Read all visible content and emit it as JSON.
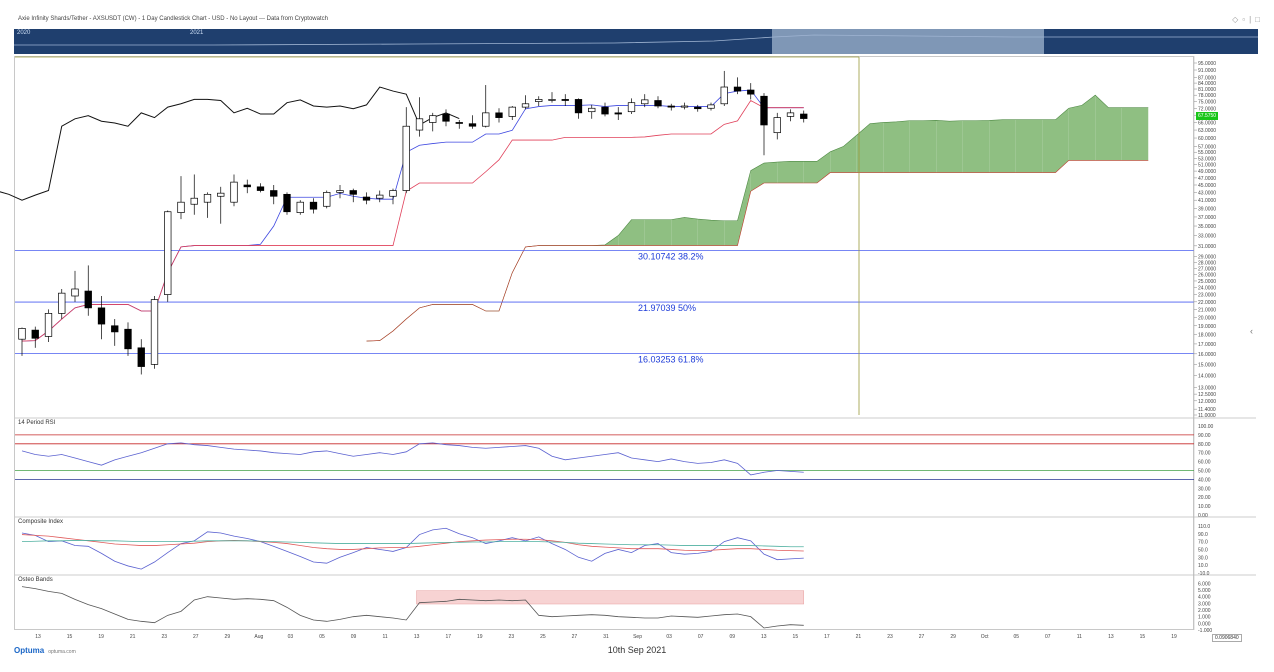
{
  "header": {
    "title": "Axie Infinity Shards/Tether - AXSUSDT (CW) - 1 Day Candlestick Chart - USD - No Layout --- Data from Cryptowatch",
    "icons": [
      "diamond-icon",
      "minimize-icon",
      "settings-icon",
      "close-icon"
    ]
  },
  "navigator": {
    "year_labels": [
      "2020",
      "2021"
    ]
  },
  "price_tag": "67.5750",
  "footer": {
    "logo": "Optuma",
    "site": "optuma.com",
    "date": "10th Sep 2021",
    "zoom": "0.0906840"
  },
  "colors": {
    "cloud": "#8fbf82",
    "tenkan": "#3d47e0",
    "kijun": "#e0405a",
    "chikou": "#111111",
    "fib": "#4a5ef0",
    "rsi": "#5a61d0"
  },
  "chart_data": [
    {
      "type": "candlestick",
      "title": "Axie Infinity Shards/Tether - AXSUSDT (CW) - 1 Day Candlestick Chart",
      "y_axis_labels": [
        "95.0000",
        "91.0000",
        "87.0000",
        "84.0000",
        "81.0000",
        "78.0000",
        "75.0000",
        "72.0000",
        "69.0000",
        "66.0000",
        "63.0000",
        "60.0000",
        "57.0000",
        "55.0000",
        "53.0000",
        "51.0000",
        "49.0000",
        "47.0000",
        "45.0000",
        "43.0000",
        "41.0000",
        "39.0000",
        "37.0000",
        "35.0000",
        "33.0000",
        "31.0000",
        "29.0000",
        "28.0000",
        "27.0000",
        "26.0000",
        "25.0000",
        "24.0000",
        "23.0000",
        "22.0000",
        "21.0000",
        "20.0000",
        "19.0000",
        "18.0000",
        "17.0000",
        "16.0000",
        "15.0000",
        "14.0000",
        "13.0000",
        "12.5000",
        "12.0000",
        "11.4000",
        "11.0000"
      ],
      "x_axis_labels": [
        "13",
        "15",
        "19",
        "21",
        "23",
        "27",
        "29",
        "Aug",
        "03",
        "05",
        "09",
        "11",
        "13",
        "17",
        "19",
        "23",
        "25",
        "27",
        "31",
        "Sep",
        "03",
        "07",
        "09",
        "13",
        "15",
        "17",
        "21",
        "23",
        "27",
        "29",
        "Oct",
        "05",
        "07",
        "11",
        "13",
        "15",
        "19"
      ],
      "candles": [
        {
          "o": 17.5,
          "h": 18.8,
          "l": 15.8,
          "c": 18.7
        },
        {
          "o": 18.5,
          "h": 18.9,
          "l": 16.6,
          "c": 17.6
        },
        {
          "o": 17.8,
          "h": 21.0,
          "l": 17.2,
          "c": 20.5
        },
        {
          "o": 20.5,
          "h": 23.8,
          "l": 19.8,
          "c": 23.2
        },
        {
          "o": 22.8,
          "h": 26.6,
          "l": 22.0,
          "c": 23.8
        },
        {
          "o": 23.5,
          "h": 27.5,
          "l": 20.2,
          "c": 21.2
        },
        {
          "o": 21.2,
          "h": 22.8,
          "l": 17.5,
          "c": 19.2
        },
        {
          "o": 19.0,
          "h": 19.8,
          "l": 16.8,
          "c": 18.3
        },
        {
          "o": 18.6,
          "h": 19.4,
          "l": 15.8,
          "c": 16.5
        },
        {
          "o": 16.6,
          "h": 17.5,
          "l": 14.1,
          "c": 14.8
        },
        {
          "o": 15.0,
          "h": 22.8,
          "l": 14.6,
          "c": 22.3
        },
        {
          "o": 23.0,
          "h": 38.5,
          "l": 22.0,
          "c": 38.2
        },
        {
          "o": 38.0,
          "h": 47.5,
          "l": 36.5,
          "c": 40.5
        },
        {
          "o": 40.0,
          "h": 48.0,
          "l": 37.5,
          "c": 41.5
        },
        {
          "o": 40.5,
          "h": 43.0,
          "l": 36.8,
          "c": 42.5
        },
        {
          "o": 42.0,
          "h": 44.5,
          "l": 35.5,
          "c": 42.8
        },
        {
          "o": 40.5,
          "h": 48.0,
          "l": 39.5,
          "c": 45.8
        },
        {
          "o": 45.0,
          "h": 46.5,
          "l": 42.8,
          "c": 44.5
        },
        {
          "o": 44.5,
          "h": 45.5,
          "l": 43.0,
          "c": 43.5
        },
        {
          "o": 43.5,
          "h": 45.0,
          "l": 40.0,
          "c": 42.0
        },
        {
          "o": 42.5,
          "h": 43.0,
          "l": 37.5,
          "c": 38.2
        },
        {
          "o": 38.0,
          "h": 41.0,
          "l": 37.5,
          "c": 40.5
        },
        {
          "o": 40.5,
          "h": 41.5,
          "l": 37.8,
          "c": 38.8
        },
        {
          "o": 39.5,
          "h": 43.5,
          "l": 39.0,
          "c": 43.0
        },
        {
          "o": 43.0,
          "h": 45.0,
          "l": 41.5,
          "c": 43.5
        },
        {
          "o": 43.5,
          "h": 44.0,
          "l": 40.5,
          "c": 42.5
        },
        {
          "o": 41.8,
          "h": 43.0,
          "l": 40.0,
          "c": 41.0
        },
        {
          "o": 41.5,
          "h": 43.5,
          "l": 40.5,
          "c": 42.3
        },
        {
          "o": 42.0,
          "h": 44.0,
          "l": 40.0,
          "c": 43.5
        },
        {
          "o": 43.5,
          "h": 72.5,
          "l": 42.8,
          "c": 64.5
        },
        {
          "o": 63.0,
          "h": 77.0,
          "l": 60.5,
          "c": 67.5
        },
        {
          "o": 66.0,
          "h": 70.0,
          "l": 62.5,
          "c": 68.8
        },
        {
          "o": 69.5,
          "h": 71.5,
          "l": 64.5,
          "c": 66.5
        },
        {
          "o": 66.0,
          "h": 67.0,
          "l": 63.5,
          "c": 65.8
        },
        {
          "o": 65.5,
          "h": 69.0,
          "l": 63.5,
          "c": 64.5
        },
        {
          "o": 64.5,
          "h": 83.0,
          "l": 64.0,
          "c": 70.0
        },
        {
          "o": 70.0,
          "h": 72.0,
          "l": 66.0,
          "c": 68.0
        },
        {
          "o": 68.5,
          "h": 73.0,
          "l": 67.0,
          "c": 72.5
        },
        {
          "o": 72.5,
          "h": 78.0,
          "l": 71.5,
          "c": 74.0
        },
        {
          "o": 75.0,
          "h": 77.5,
          "l": 73.0,
          "c": 76.0
        },
        {
          "o": 76.0,
          "h": 79.5,
          "l": 74.5,
          "c": 76.0
        },
        {
          "o": 76.0,
          "h": 78.5,
          "l": 73.0,
          "c": 75.5
        },
        {
          "o": 76.0,
          "h": 76.5,
          "l": 67.5,
          "c": 70.0
        },
        {
          "o": 70.5,
          "h": 73.5,
          "l": 67.5,
          "c": 72.0
        },
        {
          "o": 72.5,
          "h": 74.5,
          "l": 68.5,
          "c": 69.5
        },
        {
          "o": 70.0,
          "h": 72.5,
          "l": 67.0,
          "c": 69.5
        },
        {
          "o": 70.5,
          "h": 76.5,
          "l": 69.5,
          "c": 74.5
        },
        {
          "o": 74.0,
          "h": 78.5,
          "l": 72.5,
          "c": 75.8
        },
        {
          "o": 75.5,
          "h": 77.5,
          "l": 72.0,
          "c": 73.0
        },
        {
          "o": 73.0,
          "h": 74.0,
          "l": 71.0,
          "c": 72.5
        },
        {
          "o": 72.5,
          "h": 74.5,
          "l": 71.5,
          "c": 73.0
        },
        {
          "o": 72.5,
          "h": 73.5,
          "l": 70.5,
          "c": 71.8
        },
        {
          "o": 72.0,
          "h": 74.5,
          "l": 71.0,
          "c": 73.5
        },
        {
          "o": 74.0,
          "h": 90.5,
          "l": 73.0,
          "c": 82.0
        },
        {
          "o": 82.0,
          "h": 87.0,
          "l": 78.5,
          "c": 80.0
        },
        {
          "o": 80.5,
          "h": 84.0,
          "l": 76.0,
          "c": 78.5
        },
        {
          "o": 77.5,
          "h": 79.0,
          "l": 54.0,
          "c": 65.0
        },
        {
          "o": 62.0,
          "h": 70.0,
          "l": 59.5,
          "c": 68.0
        },
        {
          "o": 68.5,
          "h": 71.5,
          "l": 66.5,
          "c": 70.0
        },
        {
          "o": 69.5,
          "h": 71.0,
          "l": 66.0,
          "c": 67.6
        }
      ],
      "fib_levels": [
        {
          "price": 30.10742,
          "label": "30.10742",
          "pct": "38.2%"
        },
        {
          "price": 21.97039,
          "label": "21.97039",
          "pct": "50%"
        },
        {
          "price": 16.03253,
          "label": "16.03253",
          "pct": "61.8%"
        }
      ],
      "last_price": 67.575
    },
    {
      "type": "line",
      "title": "14 Period RSI",
      "y_axis_labels": [
        "100.00",
        "90.00",
        "80.00",
        "70.00",
        "60.00",
        "50.00",
        "40.00",
        "30.00",
        "20.00",
        "10.00",
        "0.00"
      ],
      "ylim": [
        0,
        100
      ],
      "levels": [
        90,
        80,
        50,
        40
      ],
      "values": [
        72,
        68,
        66,
        68,
        64,
        60,
        56,
        62,
        66,
        70,
        75,
        80,
        81,
        79,
        78,
        76,
        74,
        73,
        72,
        70,
        69,
        68,
        71,
        72,
        69,
        66,
        68,
        70,
        68,
        71,
        80,
        81,
        79,
        78,
        76,
        75,
        76,
        77,
        78,
        75,
        66,
        62,
        64,
        66,
        68,
        70,
        64,
        62,
        60,
        63,
        60,
        58,
        59,
        62,
        58,
        45,
        48,
        50,
        49,
        48
      ]
    },
    {
      "type": "line",
      "title": "Composite Index",
      "y_axis_labels": [
        "110.0",
        "90.0",
        "70.0",
        "50.0",
        "30.0",
        "10.0",
        "-10.0"
      ],
      "ylim": [
        -10,
        120
      ],
      "series": [
        {
          "values": [
            92,
            86,
            70,
            72,
            60,
            58,
            40,
            20,
            8,
            0,
            18,
            42,
            65,
            72,
            95,
            92,
            84,
            78,
            70,
            58,
            45,
            32,
            18,
            15,
            30,
            42,
            55,
            50,
            45,
            55,
            88,
            100,
            104,
            90,
            80,
            65,
            72,
            80,
            72,
            82,
            65,
            50,
            30,
            20,
            40,
            50,
            42,
            60,
            65,
            42,
            38,
            40,
            45,
            70,
            80,
            72,
            38,
            24,
            26,
            28
          ]
        },
        {
          "values": [
            88,
            86,
            84,
            80,
            76,
            72,
            68,
            64,
            62,
            60,
            60,
            62,
            64,
            66,
            70,
            72,
            73,
            72,
            70,
            68,
            65,
            60,
            55,
            52,
            50,
            50,
            52,
            54,
            55,
            55,
            58,
            62,
            66,
            70,
            72,
            74,
            75,
            76,
            76,
            75,
            72,
            68,
            62,
            58,
            56,
            54,
            52,
            52,
            52,
            50,
            48,
            47,
            48,
            50,
            52,
            52,
            50,
            48,
            47,
            46
          ]
        },
        {
          "values": [
            70,
            71,
            72,
            72,
            73,
            73,
            72,
            72,
            71,
            70,
            70,
            70,
            70,
            71,
            72,
            72,
            72,
            72,
            71,
            70,
            69,
            68,
            67,
            66,
            65,
            65,
            65,
            65,
            65,
            65,
            66,
            67,
            68,
            68,
            69,
            69,
            70,
            70,
            70,
            70,
            69,
            68,
            66,
            65,
            64,
            63,
            62,
            62,
            62,
            61,
            60,
            60,
            60,
            60,
            60,
            60,
            59,
            58,
            57,
            57
          ]
        }
      ]
    },
    {
      "type": "line",
      "title": "Osteo Bands",
      "y_axis_labels": [
        "6.000",
        "5.000",
        "4.000",
        "3.000",
        "2.000",
        "1.000",
        "0.000",
        "-1.000"
      ],
      "ylim": [
        -1,
        6.5
      ],
      "shaded_range": [
        2.9,
        4.9
      ],
      "values": [
        5.5,
        5.2,
        4.8,
        4.5,
        3.6,
        2.8,
        2.2,
        1.4,
        0.6,
        0.3,
        0.1,
        1.2,
        1.8,
        3.5,
        4.0,
        3.8,
        3.6,
        3.7,
        3.6,
        3.4,
        2.4,
        1.2,
        0.5,
        0.3,
        0.6,
        1.0,
        1.2,
        1.0,
        0.8,
        0.5,
        3.1,
        3.2,
        3.3,
        3.6,
        3.5,
        3.4,
        3.5,
        3.4,
        3.5,
        1.2,
        1.0,
        1.1,
        1.2,
        1.3,
        1.2,
        1.0,
        0.9,
        0.8,
        0.8,
        1.1,
        1.0,
        0.9,
        1.1,
        1.3,
        1.4,
        1.0,
        -0.7,
        -0.4,
        -0.2,
        -0.3
      ]
    }
  ]
}
